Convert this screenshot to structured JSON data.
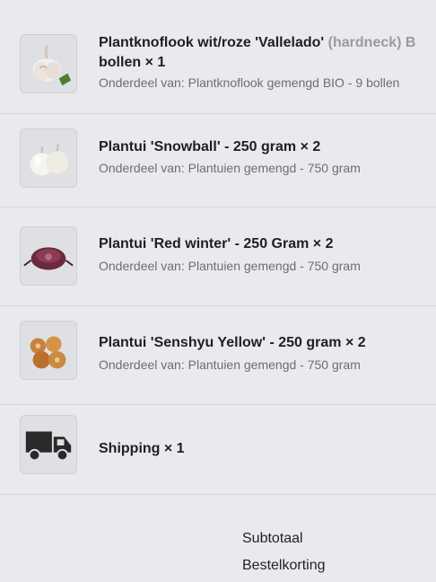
{
  "items": [
    {
      "icon": "garlic-icon",
      "title": "Plantknoflook wit/roze 'Vallelado'",
      "title_tail": "(hardneck) B",
      "title_line2": "bollen",
      "qty": "× 1",
      "subtitle": "Onderdeel van: Plantknoflook gemengd BIO - 9 bollen"
    },
    {
      "icon": "white-onion-icon",
      "title": "Plantui 'Snowball' - 250 gram",
      "qty": "× 2",
      "subtitle": "Onderdeel van: Plantuien gemengd - 750 gram"
    },
    {
      "icon": "red-onion-icon",
      "title": "Plantui 'Red winter' - 250 Gram",
      "qty": "× 2",
      "subtitle": "Onderdeel van: Plantuien gemengd - 750 gram"
    },
    {
      "icon": "yellow-onion-icon",
      "title": "Plantui 'Senshyu Yellow' - 250 gram",
      "qty": "× 2",
      "subtitle": "Onderdeel van: Plantuien gemengd - 750 gram"
    },
    {
      "icon": "truck-icon",
      "title": "Shipping",
      "qty": "× 1"
    }
  ],
  "totals": {
    "subtotal_label": "Subtotaal",
    "discount_label": "Bestelkorting"
  }
}
